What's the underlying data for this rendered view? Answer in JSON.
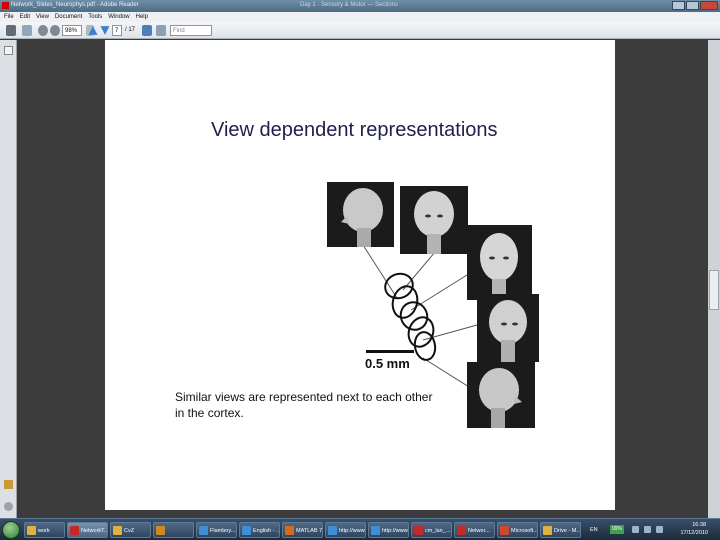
{
  "window": {
    "title": "Network_Slides_Neurophys.pdf - Adobe Reader",
    "center_title": "Day 1 · Sensory & Motor — Sections",
    "icon": "adobe-reader-icon"
  },
  "menu": [
    "File",
    "Edit",
    "View",
    "Document",
    "Tools",
    "Window",
    "Help"
  ],
  "toolbar": {
    "zoom_value": "98%",
    "page_current": "7",
    "page_total": "/ 17",
    "find_placeholder": "Find"
  },
  "slide": {
    "title": "View dependent representations",
    "scale_label": "0.5 mm",
    "caption": "Similar views are represented next to each other in the cortex."
  },
  "taskbar": {
    "tasks": [
      {
        "label": "work",
        "icon": "folder-icon",
        "color": "#e0b040"
      },
      {
        "label": "NetworkT...",
        "icon": "adobe-icon",
        "color": "#c62828"
      },
      {
        "label": "CvZ",
        "icon": "folder-icon",
        "color": "#e0b040"
      },
      {
        "label": "",
        "icon": "media-icon",
        "color": "#d08a20"
      },
      {
        "label": "Flamboy...",
        "icon": "ie-icon",
        "color": "#3d8fd9"
      },
      {
        "label": "English - ...",
        "icon": "ie-icon",
        "color": "#3d8fd9"
      },
      {
        "label": "MATLAB 7...",
        "icon": "matlab-icon",
        "color": "#d86a1e"
      },
      {
        "label": "http://www...",
        "icon": "ie-icon",
        "color": "#3d8fd9"
      },
      {
        "label": "http://www...",
        "icon": "ie-icon",
        "color": "#3d8fd9"
      },
      {
        "label": "cm_lan_...",
        "icon": "pdf-icon",
        "color": "#c62828"
      },
      {
        "label": "Networ...",
        "icon": "adobe-icon",
        "color": "#c62828"
      },
      {
        "label": "Microsoft...",
        "icon": "office-icon",
        "color": "#d04a2a"
      },
      {
        "label": "Drive - M...",
        "icon": "folder-icon",
        "color": "#e0b040"
      }
    ],
    "language": "EN",
    "battery": "99%",
    "time": "16:38",
    "date": "17/12/2010"
  }
}
